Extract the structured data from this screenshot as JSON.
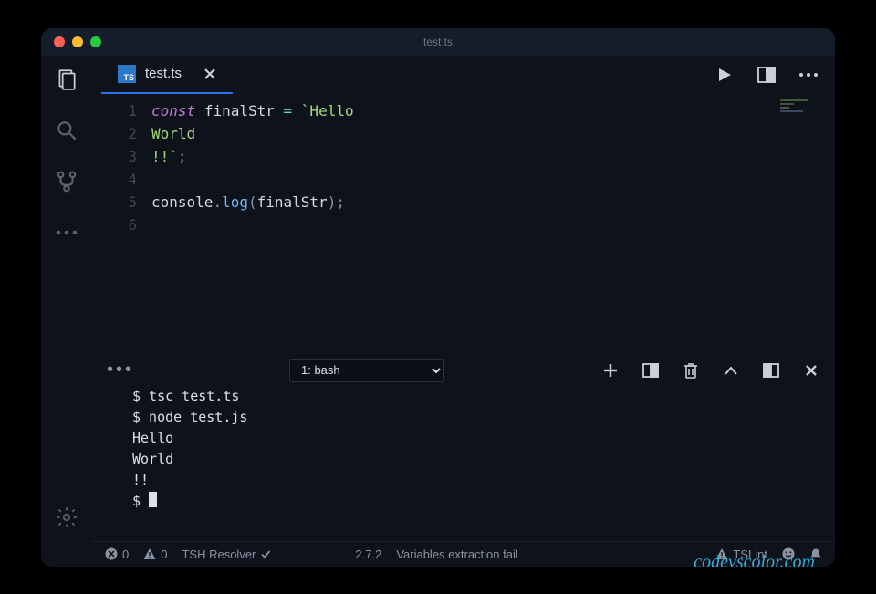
{
  "titlebar": {
    "title": "test.ts"
  },
  "tab": {
    "file_badge": "TS",
    "file_name": "test.ts"
  },
  "editor": {
    "line_numbers": [
      "1",
      "2",
      "3",
      "4",
      "5",
      "6"
    ],
    "tokens": {
      "l1_kw": "const",
      "l1_ident": "finalStr",
      "l1_op": "=",
      "l1_str": "`Hello",
      "l2_str": "World",
      "l3_str": "!!`",
      "l3_punct": ";",
      "l5_obj": "console",
      "l5_dot": ".",
      "l5_meth": "log",
      "l5_open": "(",
      "l5_arg": "finalStr",
      "l5_close": ")",
      "l5_sc": ";"
    }
  },
  "panel": {
    "selector": "1: bash",
    "terminal_lines": [
      "$ tsc test.ts",
      "$ node test.js",
      "Hello",
      "World",
      "!!",
      "$ "
    ]
  },
  "watermark": "codevscolor.com",
  "status": {
    "errors": "0",
    "warnings": "0",
    "resolver": "TSH Resolver",
    "ts_version": "2.7.2",
    "extraction": "Variables extraction fail",
    "lint": "TSLint"
  }
}
